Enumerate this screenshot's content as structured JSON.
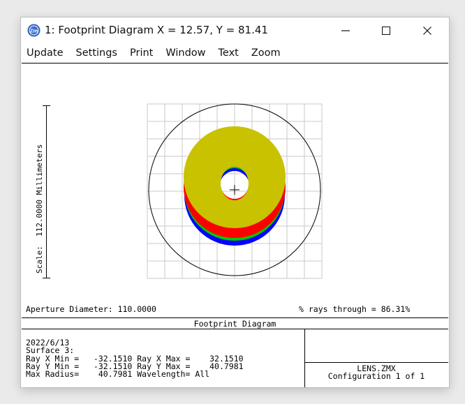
{
  "window": {
    "title": "1: Footprint Diagram X = 12.57, Y = 81.41",
    "app_icon": "zemax-logo-icon",
    "controls": {
      "minimize": "—",
      "maximize": "☐",
      "close": "✕"
    }
  },
  "menu": [
    {
      "label": "Update"
    },
    {
      "label": "Settings"
    },
    {
      "label": "Print"
    },
    {
      "label": "Window"
    },
    {
      "label": "Text"
    },
    {
      "label": "Zoom"
    }
  ],
  "plot": {
    "scale_label": "Scale:  112.0000 Millimeters",
    "aperture_diameter": "Aperture Diameter: 110.0000",
    "rays_through": "% rays through = 86.31%",
    "colors": {
      "grid": "#c8c8c8",
      "wavelength_1": "#c8c200",
      "wavelength_2": "#ff0000",
      "wavelength_3": "#00c800",
      "wavelength_4": "#0000ff"
    }
  },
  "footer": {
    "diagram_title": "Footprint Diagram",
    "date": "2022/6/13",
    "surface": "Surface 3:",
    "row1": "Ray X Min =   -32.1510 Ray X Max =    32.1510",
    "row2": "Ray Y Min =   -32.1510 Ray Y Max =    40.7981",
    "row3": "Max Radius=    40.7981 Wavelength= All",
    "file_name": "LENS.ZMX",
    "configuration": "Configuration 1 of 1"
  }
}
